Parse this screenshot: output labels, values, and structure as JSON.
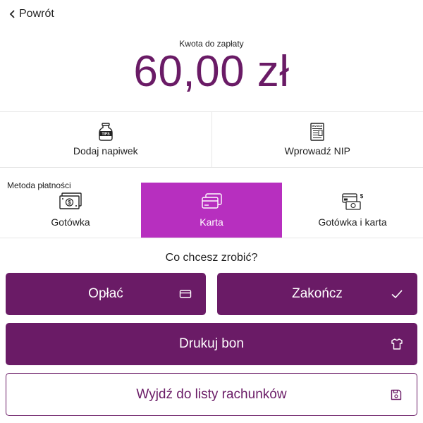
{
  "header": {
    "back_label": "Powrót"
  },
  "payment": {
    "amount_label": "Kwota do zapłaty",
    "amount": "60,00 zł"
  },
  "options": [
    {
      "label": "Dodaj napiwek",
      "icon": "tip-jar-icon",
      "icon_text": "TIPS"
    },
    {
      "label": "Wprowadź NIP",
      "icon": "invoice-icon",
      "icon_text": "INVOICE"
    }
  ],
  "methods": {
    "label": "Metoda płatności",
    "items": [
      {
        "label": "Gotówka",
        "icon": "cash-icon",
        "selected": false
      },
      {
        "label": "Karta",
        "icon": "card-icon",
        "selected": true
      },
      {
        "label": "Gotówka i karta",
        "icon": "cash-and-card-icon",
        "selected": false
      }
    ]
  },
  "actions": {
    "question": "Co chcesz zrobić?",
    "pay": {
      "label": "Opłać",
      "icon": "card-icon"
    },
    "finish": {
      "label": "Zakończ",
      "icon": "check-icon"
    },
    "print": {
      "label": "Drukuj bon",
      "icon": "shirt-icon"
    },
    "exit": {
      "label": "Wyjdź do listy rachunków",
      "icon": "save-icon"
    }
  },
  "colors": {
    "primary": "#6a1b66",
    "accent": "#b72fbf",
    "divider": "#e6e6e6"
  }
}
